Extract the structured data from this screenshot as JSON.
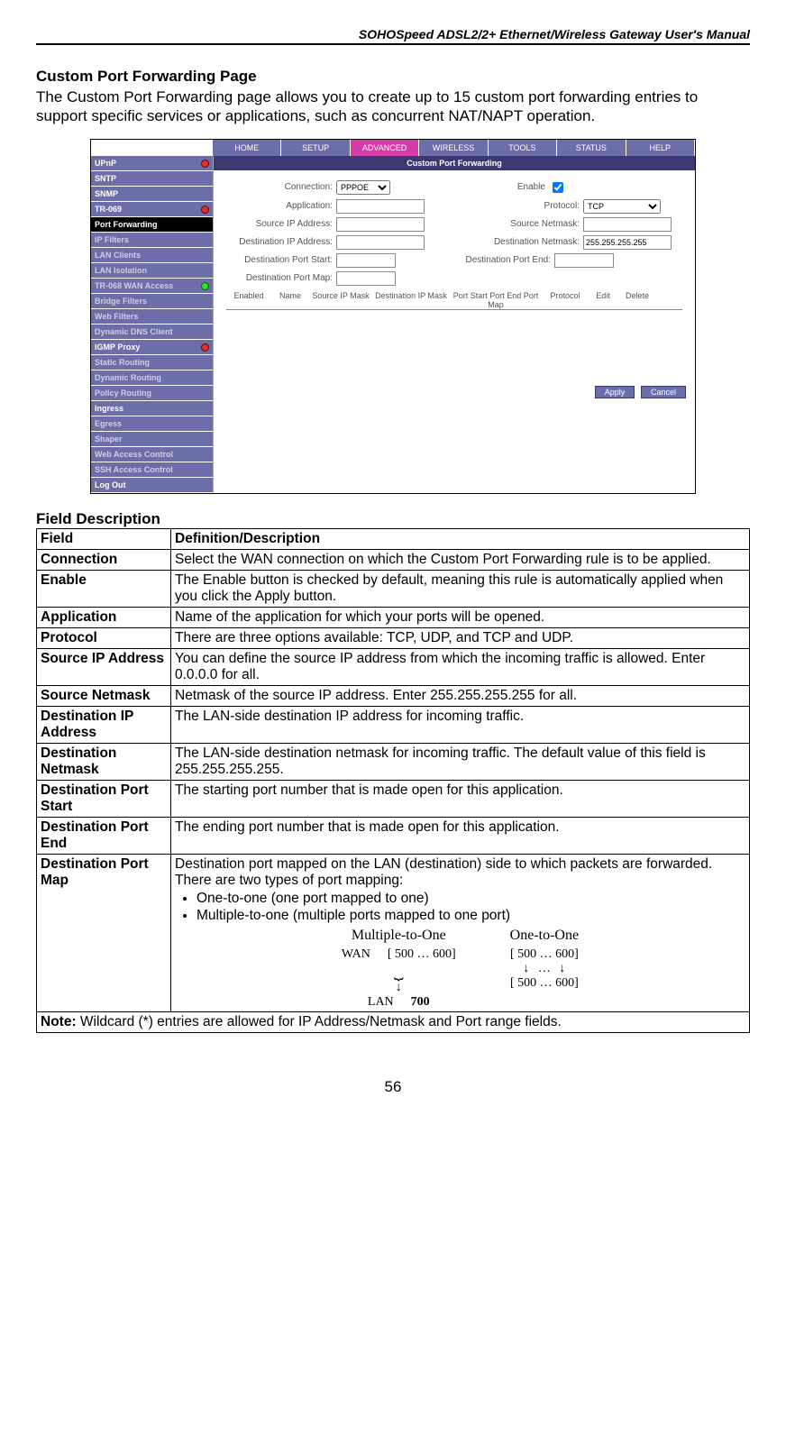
{
  "header": "SOHOSpeed ADSL2/2+ Ethernet/Wireless Gateway User's Manual",
  "title": "Custom Port Forwarding Page",
  "intro": "The Custom Port Forwarding page allows you to create up to 15 custom port forwarding entries to support specific services or applications, such as concurrent NAT/NAPT operation.",
  "nav": {
    "tabs": [
      "HOME",
      "SETUP",
      "ADVANCED",
      "WIRELESS",
      "TOOLS",
      "STATUS",
      "HELP"
    ],
    "active": "ADVANCED"
  },
  "side": [
    {
      "l": "UPnP",
      "dot": "r"
    },
    {
      "l": "SNTP"
    },
    {
      "l": "SNMP"
    },
    {
      "l": "TR-069",
      "dot": "r"
    },
    {
      "l": "Port Forwarding",
      "sel": true
    },
    {
      "l": "IP Filters",
      "muted": true
    },
    {
      "l": "LAN Clients",
      "muted": true
    },
    {
      "l": "LAN Isolation",
      "muted": true
    },
    {
      "l": "TR-068 WAN Access",
      "muted": true,
      "dot": "g"
    },
    {
      "l": "Bridge Filters",
      "muted": true
    },
    {
      "l": "Web Filters",
      "muted": true
    },
    {
      "l": "Dynamic DNS Client",
      "muted": true
    },
    {
      "l": "IGMP Proxy",
      "dot": "r"
    },
    {
      "l": "Static Routing",
      "muted": true
    },
    {
      "l": "Dynamic Routing",
      "muted": true
    },
    {
      "l": "Policy Routing",
      "muted": true
    },
    {
      "l": "Ingress"
    },
    {
      "l": "Egress",
      "muted": true
    },
    {
      "l": "Shaper",
      "muted": true
    },
    {
      "l": "Web Access Control",
      "muted": true
    },
    {
      "l": "SSH Access Control",
      "muted": true
    },
    {
      "l": "Log Out"
    }
  ],
  "panel": {
    "title": "Custom Port Forwarding",
    "connection": {
      "label": "Connection:",
      "value": "PPPOE"
    },
    "enable": {
      "label": "Enable",
      "checked": true
    },
    "application": {
      "label": "Application:",
      "value": ""
    },
    "protocol": {
      "label": "Protocol:",
      "value": "TCP"
    },
    "srcip": {
      "label": "Source IP Address:",
      "value": ""
    },
    "srcmask": {
      "label": "Source Netmask:",
      "value": ""
    },
    "dstip": {
      "label": "Destination IP Address:",
      "value": ""
    },
    "dstmask": {
      "label": "Destination Netmask:",
      "value": "255.255.255.255"
    },
    "pstart": {
      "label": "Destination Port Start:",
      "value": ""
    },
    "pend": {
      "label": "Destination Port End:",
      "value": ""
    },
    "pmap": {
      "label": "Destination Port Map:",
      "value": ""
    },
    "cols": [
      "Enabled",
      "Name",
      "Source IP Mask",
      "Destination IP Mask",
      "Port Start Port End Port Map",
      "Protocol",
      "Edit",
      "Delete"
    ],
    "apply": "Apply",
    "cancel": "Cancel"
  },
  "fdesc": "Field Description",
  "thead": {
    "f": "Field",
    "d": "Definition/Description"
  },
  "rows": [
    {
      "f": "Connection",
      "d": "Select the WAN connection on which the Custom Port Forwarding rule is to be applied."
    },
    {
      "f": "Enable",
      "d": "The Enable button is checked by default, meaning this rule is automatically applied when you click the Apply button."
    },
    {
      "f": "Application",
      "d": "Name of the application for which your ports will be opened."
    },
    {
      "f": "Protocol",
      "d": "There are three options available: TCP, UDP, and TCP and UDP."
    },
    {
      "f": "Source IP Address",
      "d": "You can define the source IP address from which the incoming traffic is allowed. Enter 0.0.0.0 for all."
    },
    {
      "f": "Source Netmask",
      "d": "Netmask of the source IP address. Enter 255.255.255.255 for all."
    },
    {
      "f": "Destination IP Address",
      "d": "The LAN-side destination IP address for incoming traffic."
    },
    {
      "f": "Destination Netmask",
      "d": "The LAN-side destination netmask for incoming traffic. The default value of this field is 255.255.255.255."
    },
    {
      "f": "Destination Port Start",
      "d": "The starting port number that is made open for this application."
    },
    {
      "f": "Destination Port End",
      "d": "The ending port number that is made open for this application."
    }
  ],
  "maprow": {
    "f": "Destination Port Map",
    "lead": "Destination port mapped on the LAN (destination) side to which packets are forwarded. There are two types of port mapping:",
    "b1": "One-to-one (one port mapped to one)",
    "b2": "Multiple-to-one (multiple ports mapped to one port)",
    "diag": {
      "m_title": "Multiple-to-One",
      "o_title": "One-to-One",
      "wan": "WAN",
      "lan": "LAN",
      "range": "[ 500  …  600]",
      "single": "700"
    }
  },
  "note": "Note: Wildcard (*) entries are allowed for IP Address/Netmask and Port range fields.",
  "noteLabel": "Note:",
  "noteText": " Wildcard (*) entries are allowed for IP Address/Netmask and Port range fields.",
  "page": "56"
}
